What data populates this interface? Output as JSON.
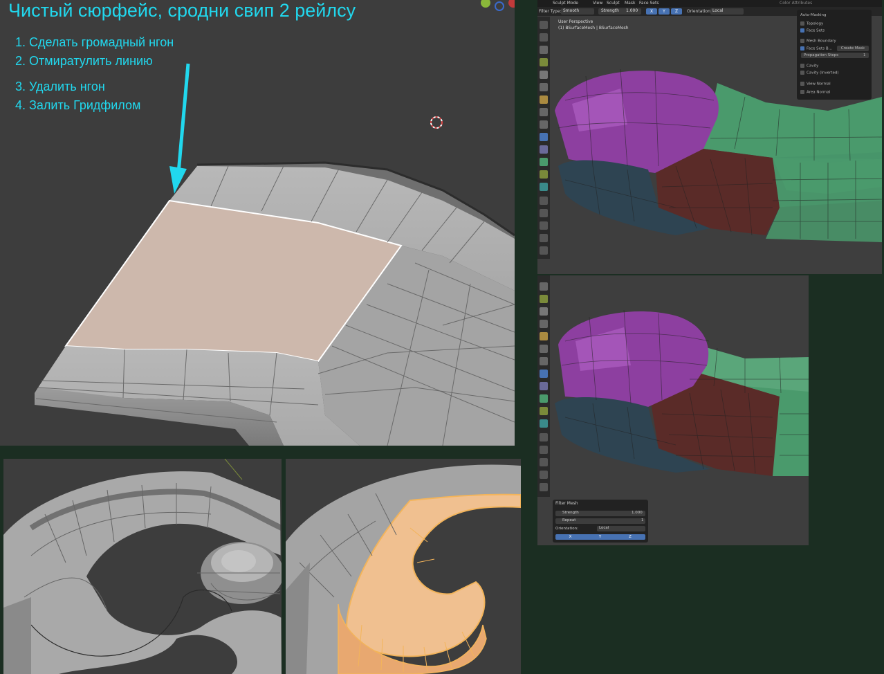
{
  "tutorial": {
    "title": "Чистый сюрфейс, сродни свип 2 рейлсу",
    "steps": [
      "1. Сделать громадный нгон",
      "2. Отмиратулить линию",
      "3. Удалить нгон",
      "4. Залить Гридфилом"
    ]
  },
  "blender_ui": {
    "top_menu": [
      "Sculpt Mode",
      "View",
      "Sculpt",
      "Mask",
      "Face Sets"
    ],
    "top_right_label": "Color Attributes",
    "header": {
      "filter_type_label": "Filter Type:",
      "filter_type_value": "Smooth",
      "strength_label": "Strength",
      "strength_value": "1.000",
      "axes": [
        "X",
        "Y",
        "Z"
      ],
      "orientation_label": "Orientation:",
      "orientation_value": "Local"
    },
    "viewport_overlay": {
      "perspective": "User Perspective",
      "object": "(1) BSurfaceMesh | BSurfaceMesh"
    },
    "auto_masking": {
      "title": "Auto-Masking",
      "options": [
        {
          "label": "Topology",
          "checked": false
        },
        {
          "label": "Face Sets",
          "checked": true
        },
        {
          "label": "Mesh Boundary",
          "checked": false
        },
        {
          "label": "Face Sets B...",
          "checked": true
        },
        {
          "label": "Cavity",
          "checked": false
        },
        {
          "label": "Cavity (Inverted)",
          "checked": false
        },
        {
          "label": "View Normal",
          "checked": false
        },
        {
          "label": "Area Normal",
          "checked": false
        }
      ],
      "create_mask_label": "Create Mask",
      "propagation_label": "Propagation Steps",
      "propagation_value": "1"
    },
    "filter_mesh_panel": {
      "title": "Filter Mesh",
      "strength_label": "Strength",
      "strength_value": "1.000",
      "repeat_label": "Repeat",
      "repeat_value": "1",
      "orientation_label": "Orientation:",
      "orientation_value": "Local",
      "axes": [
        "X",
        "Y",
        "Z"
      ]
    }
  },
  "colors": {
    "annotation": "#21d8ee",
    "background": "#1b2e22",
    "viewport": "#3d3d3d",
    "ngon": "#cdb8ac",
    "selected": "#f0a860",
    "faceset_purple": "#8d3fa0",
    "faceset_green": "#4a9a6c",
    "faceset_red": "#5a2b28",
    "faceset_blue": "#2e4452"
  }
}
